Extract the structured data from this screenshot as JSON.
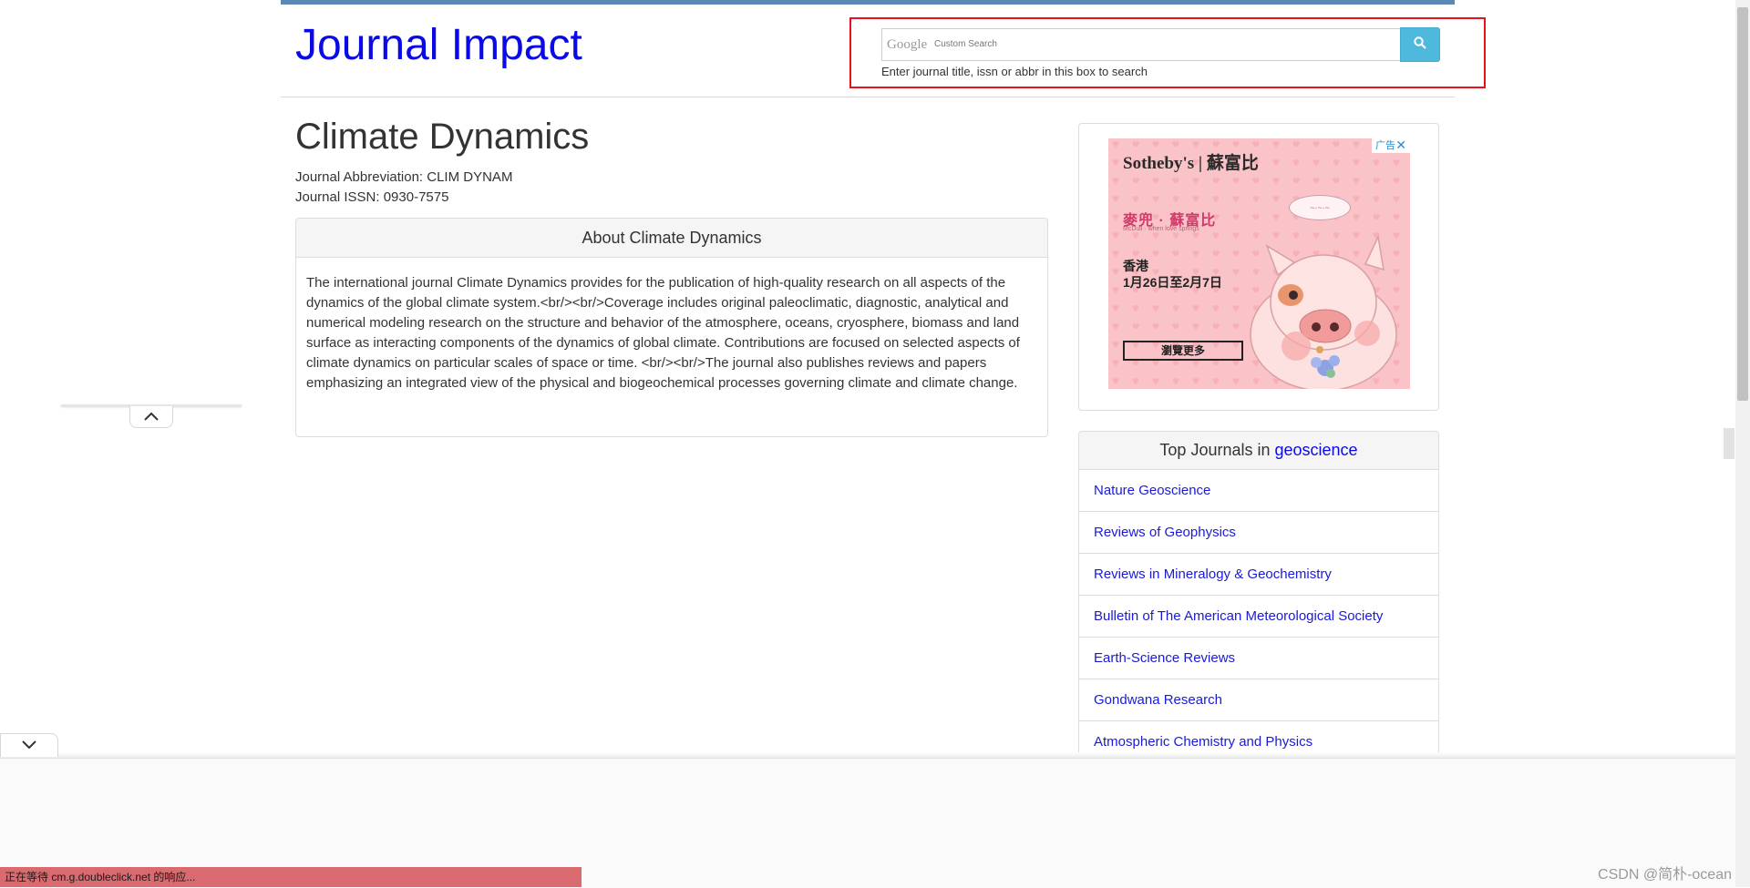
{
  "site": {
    "title": "Journal Impact"
  },
  "search": {
    "placeholder": "",
    "google_mark": "Google",
    "cse_label": "Custom Search",
    "hint": "Enter journal title, issn or abbr in this box to search",
    "button_icon": "search-icon"
  },
  "journal": {
    "name": "Climate Dynamics",
    "abbreviation": "Journal Abbreviation: CLIM DYNAM",
    "issn": "Journal ISSN: 0930-7575",
    "about_heading": "About Climate Dynamics",
    "about_text": "The international journal Climate Dynamics provides for the publication of high-quality research on all aspects of the dynamics of the global climate system.<br/><br/>Coverage includes original paleoclimatic, diagnostic, analytical and numerical modeling research on the structure and behavior of the atmosphere, oceans, cryosphere, biomass and land surface as interacting components of the dynamics of global climate. Contributions are focused on selected aspects of climate dynamics on particular scales of space or time. <br/><br/>The journal also publishes reviews and papers emphasizing an integrated view of the physical and biogeochemical processes governing climate and climate change."
  },
  "ad": {
    "brand": "Sotheby's | 蘇富比",
    "tagline": "麥兜 · 蘇富比",
    "sub": "McDull · when love springs",
    "place": "香港",
    "dates": "1月26日至2月7日",
    "cta": "瀏覽更多",
    "bubble": "~·~·~",
    "choices_label": "广告",
    "close_icon": "close-icon"
  },
  "top_journals": {
    "heading_prefix": "Top Journals in ",
    "category": "geoscience",
    "items": [
      "Nature Geoscience",
      "Reviews of Geophysics",
      "Reviews in Mineralogy & Geochemistry",
      "Bulletin of The American Meteorological Society",
      "Earth-Science Reviews",
      "Gondwana Research",
      "Atmospheric Chemistry and Physics"
    ]
  },
  "status_bar": {
    "text": "正在等待 cm.g.doubleclick.net 的响应..."
  },
  "watermark": {
    "text": "CSDN @简朴-ocean"
  },
  "colors": {
    "title_link": "#0a0ae6",
    "search_button": "#4fb8dd",
    "highlight_frame": "#e8101a",
    "top_bar": "#5b87b5",
    "status_bar": "#d86a70"
  }
}
